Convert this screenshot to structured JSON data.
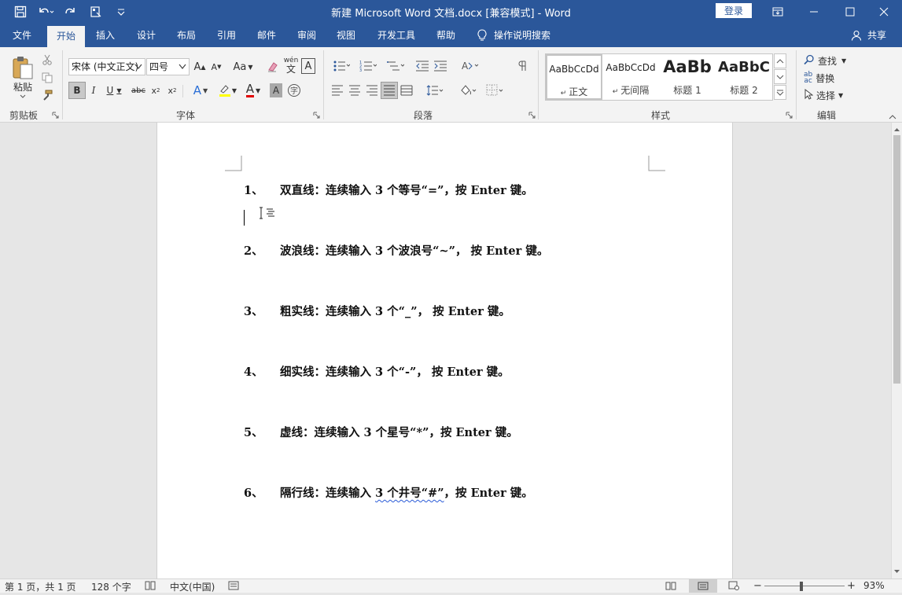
{
  "window": {
    "title": "新建 Microsoft Word 文档.docx [兼容模式]  -  Word",
    "login_label": "登录"
  },
  "tabs": [
    "文件",
    "开始",
    "插入",
    "设计",
    "布局",
    "引用",
    "邮件",
    "审阅",
    "视图",
    "开发工具",
    "帮助"
  ],
  "active_tab": "开始",
  "tell_me": "操作说明搜索",
  "share_label": "共享",
  "ribbon": {
    "clipboard": {
      "label": "剪贴板",
      "paste": "粘贴"
    },
    "font": {
      "label": "字体",
      "font_name": "宋体 (中文正文)",
      "font_size": "四号",
      "change_case": "Aa"
    },
    "paragraph": {
      "label": "段落"
    },
    "styles": {
      "label": "样式",
      "items": [
        {
          "preview": "AaBbCcDd",
          "name": "正文"
        },
        {
          "preview": "AaBbCcDd",
          "name": "无间隔"
        },
        {
          "preview": "AaBb",
          "name": "标题 1"
        },
        {
          "preview": "AaBbC",
          "name": "标题 2"
        }
      ]
    },
    "editing": {
      "label": "编辑",
      "find": "查找",
      "replace": "替换",
      "select": "选择"
    }
  },
  "document": {
    "paragraphs": [
      {
        "num": "1、",
        "text": "双直线：连续输入 3 个等号“=”，按 Enter 键。"
      },
      {
        "num": "2、",
        "text": "波浪线：连续输入 3 个波浪号“~”， 按 Enter 键。"
      },
      {
        "num": "3、",
        "text": "粗实线：连续输入 3 个“_”， 按 Enter 键。"
      },
      {
        "num": "4、",
        "text": "细实线：连续输入 3 个“-”， 按 Enter 键。"
      },
      {
        "num": "5、",
        "text": "虚线：连续输入 3 个星号“*”，按 Enter 键。"
      },
      {
        "num": "6、",
        "text_before": "隔行线：连续输入 ",
        "text_underlined": "3 个井号“#”",
        "text_after": "，按 Enter 键。"
      }
    ]
  },
  "status": {
    "page": "第 1 页，共 1 页",
    "words": "128 个字",
    "language": "中文(中国)",
    "zoom": "93%",
    "zoom_minus": "−",
    "zoom_plus": "+"
  },
  "colors": {
    "brand": "#2b579a",
    "highlight": "#ffff00",
    "font_color": "#e00000"
  }
}
